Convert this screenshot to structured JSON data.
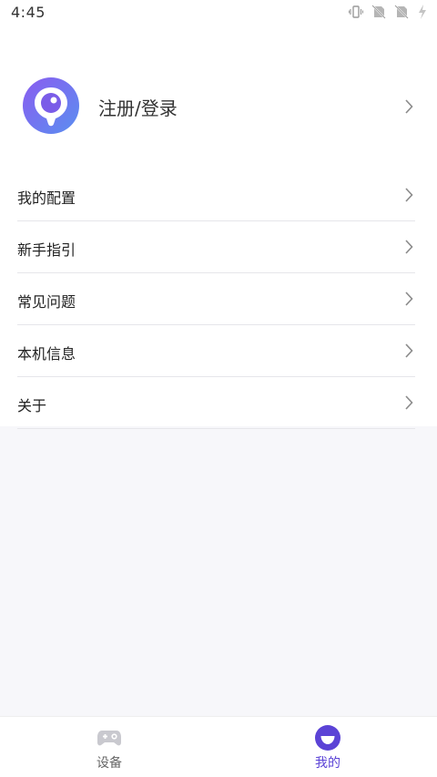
{
  "status_bar": {
    "time": "4:45",
    "icons": [
      "vibrate-icon",
      "no-sim-icon",
      "no-sim-icon",
      "battery-charging-icon"
    ]
  },
  "profile": {
    "label": "注册/登录",
    "avatar_icon": "app-logo-icon"
  },
  "menu": {
    "items": [
      {
        "label": "我的配置"
      },
      {
        "label": "新手指引"
      },
      {
        "label": "常见问题"
      },
      {
        "label": "本机信息"
      },
      {
        "label": "关于"
      }
    ]
  },
  "tabbar": {
    "tabs": [
      {
        "label": "设备",
        "icon": "gamepad-icon",
        "active": false
      },
      {
        "label": "我的",
        "icon": "smile-icon",
        "active": true
      }
    ]
  },
  "colors": {
    "accent": "#5b43d6",
    "avatar_gradient_start": "#8a5cf0",
    "avatar_gradient_end": "#5a8ff0",
    "background": "#f7f7fa",
    "divider": "#e6e6ea",
    "inactive_icon": "#c9c9cf"
  }
}
